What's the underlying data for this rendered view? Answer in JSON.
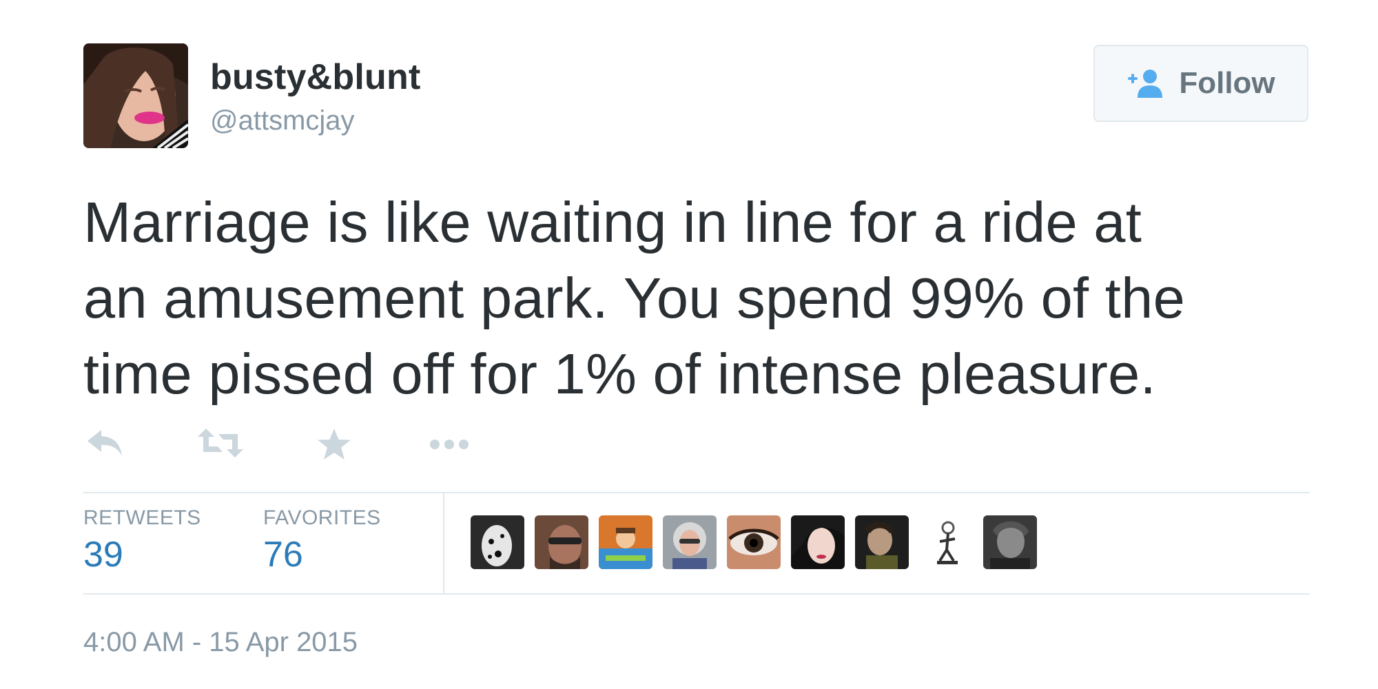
{
  "author": {
    "display_name": "busty&blunt",
    "screen_name": "@attsmcjay"
  },
  "follow_button": {
    "icon": "add-user-icon",
    "label": "Follow"
  },
  "tweet": {
    "lines": [
      "Marriage is like waiting in line for a ride at",
      "an amusement park. You spend 99% of the",
      "time pissed off for 1% of intense pleasure."
    ]
  },
  "actions": [
    {
      "icon": "reply-icon"
    },
    {
      "icon": "retweet-icon"
    },
    {
      "icon": "favorite-star-icon"
    },
    {
      "icon": "more-icon"
    }
  ],
  "stats": {
    "retweets_label": "RETWEETS",
    "retweets_count": "39",
    "favorites_label": "FAVORITES",
    "favorites_count": "76"
  },
  "favoriter_avatars": [
    {
      "icon": "favoriter-avatar-1"
    },
    {
      "icon": "favoriter-avatar-2"
    },
    {
      "icon": "favoriter-avatar-3"
    },
    {
      "icon": "favoriter-avatar-4"
    },
    {
      "icon": "favoriter-avatar-5"
    },
    {
      "icon": "favoriter-avatar-6"
    },
    {
      "icon": "favoriter-avatar-7"
    },
    {
      "icon": "favoriter-avatar-8"
    },
    {
      "icon": "favoriter-avatar-9"
    }
  ],
  "timestamp": "4:00 AM - 15 Apr 2015",
  "colors": {
    "text": "#292f33",
    "muted": "#8899a6",
    "link": "#2b7bb9",
    "icon": "#ccd6dd",
    "follow_icon": "#55acee",
    "border": "#e1e8ed"
  }
}
